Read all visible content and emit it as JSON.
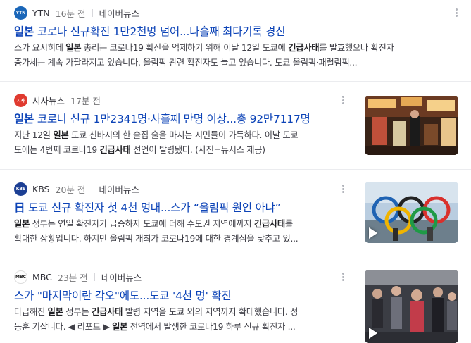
{
  "colors": {
    "title": "#0c43b7",
    "text": "#404048",
    "time": "#767678",
    "divider": "#ebecef"
  },
  "articles": [
    {
      "press": "YTN",
      "logo_icon": "ytn-logo-icon",
      "logo_text": "YTN",
      "time": "16분 전",
      "source": "네이버뉴스",
      "title_prefix": "일본",
      "title_rest": " 코로나 신규확진 1만2천명 넘어...나흘째 최다기록 경신",
      "desc_line1": [
        {
          "t": "스가 요시히데 "
        },
        {
          "t": "일본",
          "b": true
        },
        {
          "t": " 총리는 코로나19 확산을 억제하기 위해 이달 12일 도쿄에 "
        },
        {
          "t": "긴급사태",
          "b": true
        },
        {
          "t": "를 발효했으나 확진자"
        }
      ],
      "desc_line2": [
        {
          "t": "증가세는 계속 가팔라지고 있습니다. 올림픽 관련 확진자도 늘고 있습니다. 도쿄 올림픽·패럴림픽..."
        }
      ]
    },
    {
      "press": "시사뉴스",
      "logo_icon": "sisa-news-logo-icon",
      "logo_text": "시사",
      "time": "17분 전",
      "source": "",
      "title_prefix": "일본",
      "title_rest": " 코로나 신규 1만2341명·사흘째 만명 이상...총 92만7117명",
      "desc_line1": [
        {
          "t": "지난 12일 "
        },
        {
          "t": "일본",
          "b": true
        },
        {
          "t": " 도쿄 신바시의 한 술집 술을 마시는 시민들이 가득하다. 이날 도쿄"
        }
      ],
      "desc_line2": [
        {
          "t": "도에는 4번째 코로나19 "
        },
        {
          "t": "긴급사태",
          "b": true
        },
        {
          "t": " 선언이 발령됐다. (사진=뉴시스 제공)"
        }
      ]
    },
    {
      "press": "KBS",
      "logo_icon": "kbs-logo-icon",
      "logo_text": "KBS",
      "time": "20분 전",
      "source": "네이버뉴스",
      "title_prefix": "日",
      "title_rest": " 도쿄 신규 확진자 첫 4천 명대...스가 “올림픽 원인 아냐”",
      "desc_line1": [
        {
          "t": "일본",
          "b": true
        },
        {
          "t": " 정부는 연일 확진자가 급증하자 도쿄에 더해 수도권 지역에까지 "
        },
        {
          "t": "긴급사태",
          "b": true
        },
        {
          "t": "를"
        }
      ],
      "desc_line2": [
        {
          "t": "확대한 상황입니다. 하지만 올림픽 개최가 코로나19에 대한 경계심을 낮추고 있..."
        }
      ]
    },
    {
      "press": "MBC",
      "logo_icon": "mbc-logo-icon",
      "logo_text": "MBC",
      "time": "23분 전",
      "source": "네이버뉴스",
      "title_prefix": "",
      "title_rest": "스가 \"마지막이란 각오\"에도...도쿄 '4천 명' 확진",
      "desc_line1": [
        {
          "t": "다급해진 "
        },
        {
          "t": "일본",
          "b": true
        },
        {
          "t": " 정부는 "
        },
        {
          "t": "긴급사태",
          "b": true
        },
        {
          "t": " 발령 지역을 도쿄 외의 지역까지 확대했습니다. 정"
        }
      ],
      "desc_line2": [
        {
          "t": "동훈 기잡니다. ◀ 리포트 ▶ "
        },
        {
          "t": "일본",
          "b": true
        },
        {
          "t": " 전역에서 발생한 코로나19 하루 신규 확진자 ..."
        }
      ]
    }
  ]
}
